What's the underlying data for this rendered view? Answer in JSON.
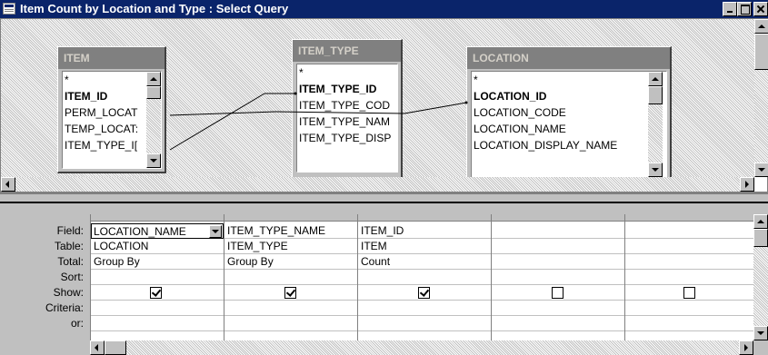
{
  "window": {
    "title": "Item Count by Location and Type : Select Query",
    "title_icon": "query-icon",
    "controls": [
      "minimize-icon",
      "maximize-icon",
      "close-icon"
    ]
  },
  "tables": [
    {
      "name": "ITEM",
      "fields": [
        {
          "name": "*",
          "key": false
        },
        {
          "name": "ITEM_ID",
          "key": true
        },
        {
          "name": "PERM_LOCAT",
          "key": false
        },
        {
          "name": "TEMP_LOCAT:",
          "key": false
        },
        {
          "name": "ITEM_TYPE_I[",
          "key": false
        }
      ]
    },
    {
      "name": "ITEM_TYPE",
      "fields": [
        {
          "name": "*",
          "key": false
        },
        {
          "name": "ITEM_TYPE_ID",
          "key": true
        },
        {
          "name": "ITEM_TYPE_COD",
          "key": false
        },
        {
          "name": "ITEM_TYPE_NAM",
          "key": false
        },
        {
          "name": "ITEM_TYPE_DISP",
          "key": false
        }
      ]
    },
    {
      "name": "LOCATION",
      "fields": [
        {
          "name": "*",
          "key": false
        },
        {
          "name": "LOCATION_ID",
          "key": true
        },
        {
          "name": "LOCATION_CODE",
          "key": false
        },
        {
          "name": "LOCATION_NAME",
          "key": false
        },
        {
          "name": "LOCATION_DISPLAY_NAME",
          "key": false
        }
      ]
    }
  ],
  "grid": {
    "row_labels": [
      "Field:",
      "Table:",
      "Total:",
      "Sort:",
      "Show:",
      "Criteria:",
      "or:"
    ],
    "columns": [
      {
        "field": "LOCATION_NAME",
        "table": "LOCATION",
        "total": "Group By",
        "sort": "",
        "show": true,
        "criteria": "",
        "or": ""
      },
      {
        "field": "ITEM_TYPE_NAME",
        "table": "ITEM_TYPE",
        "total": "Group By",
        "sort": "",
        "show": true,
        "criteria": "",
        "or": ""
      },
      {
        "field": "ITEM_ID",
        "table": "ITEM",
        "total": "Count",
        "sort": "",
        "show": true,
        "criteria": "",
        "or": ""
      },
      {
        "field": "",
        "table": "",
        "total": "",
        "sort": "",
        "show": false,
        "criteria": "",
        "or": ""
      },
      {
        "field": "",
        "table": "",
        "total": "",
        "sort": "",
        "show": false,
        "criteria": "",
        "or": ""
      }
    ]
  },
  "colors": {
    "title_bar": "#0a246a",
    "table_header": "#808080",
    "window_face": "#c0c0c0"
  }
}
